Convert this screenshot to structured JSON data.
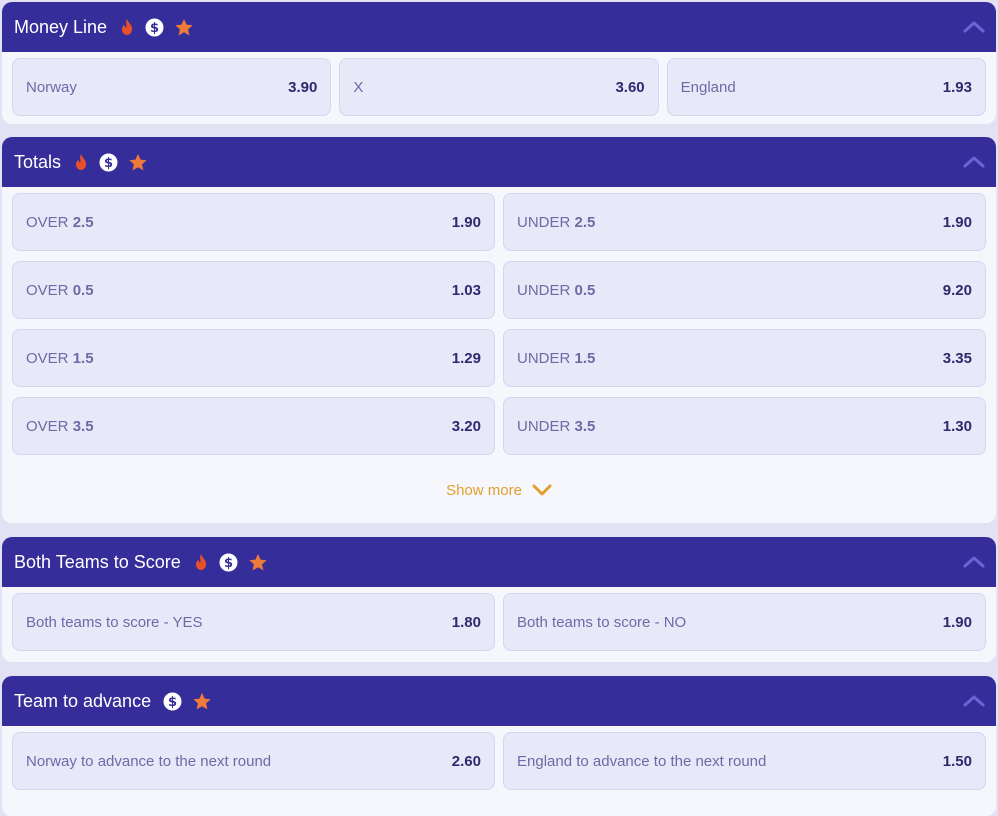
{
  "colors": {
    "header_bg": "#352d99",
    "accent_orange": "#f07a3a",
    "fire_red": "#e8502a",
    "show_more": "#e0a02e"
  },
  "money_line": {
    "title": "Money Line",
    "icons": [
      "fire-icon",
      "dollar-icon",
      "star-icon"
    ],
    "odds": [
      {
        "label": "Norway",
        "price": "3.90"
      },
      {
        "label": "X",
        "price": "3.60"
      },
      {
        "label": "England",
        "price": "1.93"
      }
    ]
  },
  "totals": {
    "title": "Totals",
    "icons": [
      "fire-icon",
      "dollar-icon",
      "star-icon"
    ],
    "rows": [
      {
        "over_prefix": "OVER ",
        "over_line": "2.5",
        "over_price": "1.90",
        "under_prefix": "UNDER ",
        "under_line": "2.5",
        "under_price": "1.90"
      },
      {
        "over_prefix": "OVER ",
        "over_line": "0.5",
        "over_price": "1.03",
        "under_prefix": "UNDER ",
        "under_line": "0.5",
        "under_price": "9.20"
      },
      {
        "over_prefix": "OVER ",
        "over_line": "1.5",
        "over_price": "1.29",
        "under_prefix": "UNDER ",
        "under_line": "1.5",
        "under_price": "3.35"
      },
      {
        "over_prefix": "OVER ",
        "over_line": "3.5",
        "over_price": "3.20",
        "under_prefix": "UNDER ",
        "under_line": "3.5",
        "under_price": "1.30"
      }
    ],
    "show_more_label": "Show more"
  },
  "btts": {
    "title": "Both Teams to Score",
    "icons": [
      "fire-icon",
      "dollar-icon",
      "star-icon"
    ],
    "odds": [
      {
        "label": "Both teams to score - YES",
        "price": "1.80"
      },
      {
        "label": "Both teams to score - NO",
        "price": "1.90"
      }
    ]
  },
  "advance": {
    "title": "Team to advance",
    "icons": [
      "dollar-icon",
      "star-icon"
    ],
    "odds": [
      {
        "label": "Norway to advance to the next round",
        "price": "2.60"
      },
      {
        "label": "England to advance to the next round",
        "price": "1.50"
      }
    ]
  }
}
